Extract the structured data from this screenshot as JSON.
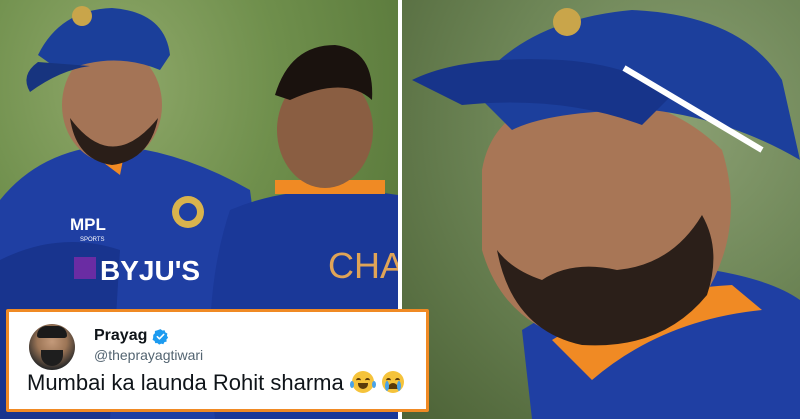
{
  "tweet": {
    "display_name": "Prayag",
    "handle": "@theprayagtiwari",
    "text": "Mumbai ka launda Rohit sharma",
    "emojis": [
      "face-with-tears-of-joy",
      "loudly-crying-face"
    ]
  },
  "photo_left": {
    "jersey_sponsor": "BYJU'S",
    "kit_sponsor": "MPL",
    "kit_sponsor_sub": "SPORTS",
    "back_name": "CHA"
  },
  "colors": {
    "jersey_blue": "#1f3fa3",
    "jersey_dark": "#12277a",
    "accent_orange": "#f08a24",
    "pitch_green": "#6f8f4c",
    "verified_blue": "#1d9bf0"
  }
}
